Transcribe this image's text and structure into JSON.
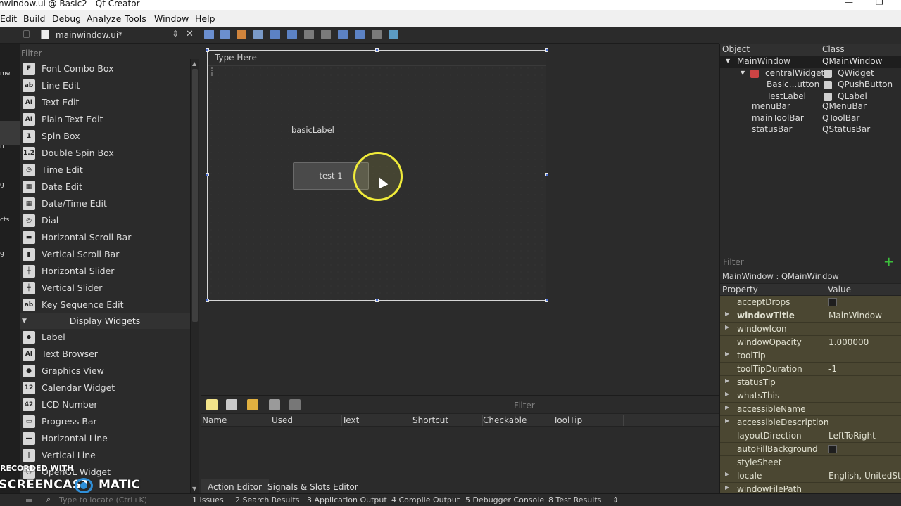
{
  "window": {
    "title": "nwindow.ui @ Basic2 - Qt Creator",
    "minimize": "—",
    "maximize": "❐"
  },
  "menubar": [
    "Edit",
    "Build",
    "Debug",
    "Analyze",
    "Tools",
    "Window",
    "Help"
  ],
  "editor_tab": {
    "filename": "mainwindow.ui*",
    "arrows": "⇕",
    "close": "✕"
  },
  "left_edge_fragments": [
    "me",
    "n",
    "g",
    "cts",
    "g"
  ],
  "widgetbox": {
    "filter_placeholder": "Filter",
    "items_input": [
      {
        "label": "Font Combo Box",
        "icon": "font-combo-icon",
        "glyph": "F"
      },
      {
        "label": "Line Edit",
        "icon": "line-edit-icon",
        "glyph": "ab"
      },
      {
        "label": "Text Edit",
        "icon": "text-edit-icon",
        "glyph": "AI"
      },
      {
        "label": "Plain Text Edit",
        "icon": "plain-text-edit-icon",
        "glyph": "AI"
      },
      {
        "label": "Spin Box",
        "icon": "spin-box-icon",
        "glyph": "1"
      },
      {
        "label": "Double Spin Box",
        "icon": "double-spin-box-icon",
        "glyph": "1.2"
      },
      {
        "label": "Time Edit",
        "icon": "clock-icon",
        "glyph": "◷"
      },
      {
        "label": "Date Edit",
        "icon": "calendar-icon",
        "glyph": "▦"
      },
      {
        "label": "Date/Time Edit",
        "icon": "date-time-icon",
        "glyph": "▦"
      },
      {
        "label": "Dial",
        "icon": "dial-icon",
        "glyph": "◎"
      },
      {
        "label": "Horizontal Scroll Bar",
        "icon": "hscroll-icon",
        "glyph": "▬"
      },
      {
        "label": "Vertical Scroll Bar",
        "icon": "vscroll-icon",
        "glyph": "▮"
      },
      {
        "label": "Horizontal Slider",
        "icon": "hslider-icon",
        "glyph": "┼"
      },
      {
        "label": "Vertical Slider",
        "icon": "vslider-icon",
        "glyph": "╪"
      },
      {
        "label": "Key Sequence Edit",
        "icon": "key-sequence-icon",
        "glyph": "ab"
      }
    ],
    "category_display": "Display Widgets",
    "items_display": [
      {
        "label": "Label",
        "icon": "label-tag-icon",
        "glyph": "◆"
      },
      {
        "label": "Text Browser",
        "icon": "text-browser-icon",
        "glyph": "AI"
      },
      {
        "label": "Graphics View",
        "icon": "graphics-view-icon",
        "glyph": "●"
      },
      {
        "label": "Calendar Widget",
        "icon": "calendar-widget-icon",
        "glyph": "12"
      },
      {
        "label": "LCD Number",
        "icon": "lcd-number-icon",
        "glyph": "42"
      },
      {
        "label": "Progress Bar",
        "icon": "progress-bar-icon",
        "glyph": "▭"
      },
      {
        "label": "Horizontal Line",
        "icon": "hline-icon",
        "glyph": "—"
      },
      {
        "label": "Vertical Line",
        "icon": "vline-icon",
        "glyph": "|"
      },
      {
        "label": "OpenGL Widget",
        "icon": "opengl-icon",
        "glyph": "⬡"
      }
    ]
  },
  "watermark": {
    "recorded": "RECORDED WITH",
    "brand_a": "SCREENCAST",
    "brand_b": "MATIC"
  },
  "form": {
    "type_here": "Type Here",
    "basic_label": "basicLabel",
    "button_text": "test 1"
  },
  "action_editor": {
    "filter_placeholder": "Filter",
    "columns": [
      "Name",
      "Used",
      "Text",
      "Shortcut",
      "Checkable",
      "ToolTip"
    ],
    "tabs": [
      "Action Editor",
      "Signals & Slots Editor"
    ]
  },
  "object_inspector": {
    "col_object": "Object",
    "col_class": "Class",
    "rows": [
      {
        "object": "MainWindow",
        "class": "QMainWindow",
        "indent": 0
      },
      {
        "object": "centralWidget",
        "class": "QWidget",
        "indent": 1
      },
      {
        "object": "Basic...utton",
        "class": "QPushButton",
        "indent": 2
      },
      {
        "object": "TestLabel",
        "class": "QLabel",
        "indent": 2
      },
      {
        "object": "menuBar",
        "class": "QMenuBar",
        "indent": 1
      },
      {
        "object": "mainToolBar",
        "class": "QToolBar",
        "indent": 1
      },
      {
        "object": "statusBar",
        "class": "QStatusBar",
        "indent": 1
      }
    ]
  },
  "property_editor": {
    "filter_placeholder": "Filter",
    "plus": "+",
    "object_name": "MainWindow : QMainWindow",
    "col_property": "Property",
    "col_value": "Value",
    "rows": [
      {
        "name": "acceptDrops",
        "value": "",
        "checkbox": true,
        "expandable": false,
        "bold": false
      },
      {
        "name": "windowTitle",
        "value": "MainWindow",
        "checkbox": false,
        "expandable": true,
        "bold": true
      },
      {
        "name": "windowIcon",
        "value": "",
        "checkbox": false,
        "expandable": true,
        "bold": false
      },
      {
        "name": "windowOpacity",
        "value": "1.000000",
        "checkbox": false,
        "expandable": false,
        "bold": false
      },
      {
        "name": "toolTip",
        "value": "",
        "checkbox": false,
        "expandable": true,
        "bold": false
      },
      {
        "name": "toolTipDuration",
        "value": "-1",
        "checkbox": false,
        "expandable": false,
        "bold": false
      },
      {
        "name": "statusTip",
        "value": "",
        "checkbox": false,
        "expandable": true,
        "bold": false
      },
      {
        "name": "whatsThis",
        "value": "",
        "checkbox": false,
        "expandable": true,
        "bold": false
      },
      {
        "name": "accessibleName",
        "value": "",
        "checkbox": false,
        "expandable": true,
        "bold": false
      },
      {
        "name": "accessibleDescription",
        "value": "",
        "checkbox": false,
        "expandable": true,
        "bold": false
      },
      {
        "name": "layoutDirection",
        "value": "LeftToRight",
        "checkbox": false,
        "expandable": false,
        "bold": false
      },
      {
        "name": "autoFillBackground",
        "value": "",
        "checkbox": true,
        "expandable": false,
        "bold": false
      },
      {
        "name": "styleSheet",
        "value": "",
        "checkbox": false,
        "expandable": false,
        "bold": false
      },
      {
        "name": "locale",
        "value": "English, UnitedStates",
        "checkbox": false,
        "expandable": true,
        "bold": false
      },
      {
        "name": "windowFilePath",
        "value": "",
        "checkbox": false,
        "expandable": true,
        "bold": false
      }
    ]
  },
  "statusbar": {
    "locate_placeholder": "Type to locate (Ctrl+K)",
    "panes": [
      "1  Issues",
      "2  Search Results",
      "3  Application Output",
      "4  Compile Output",
      "5  Debugger Console",
      "8  Test Results"
    ],
    "more": "⇕"
  }
}
